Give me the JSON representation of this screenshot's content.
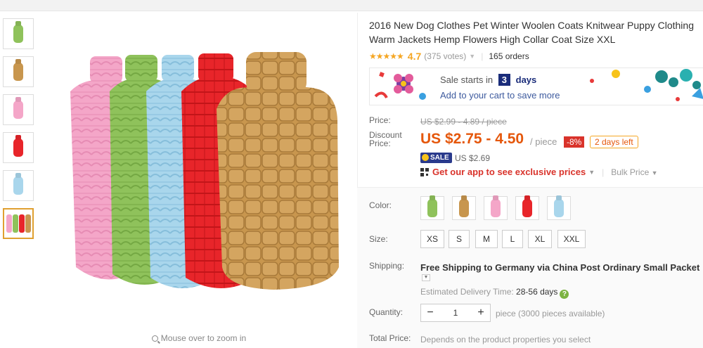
{
  "product": {
    "title": "2016 New Dog Clothes Pet Winter Woolen Coats Knitwear Puppy Clothing Warm Jackets Hemp Flowers High Collar Coat Size XXL",
    "rating": {
      "stars": "★★★★★",
      "value": "4.7",
      "votes": "(375 votes)",
      "orders": "165 orders"
    }
  },
  "thumbnails": [
    {
      "name": "green",
      "color": "#8fc25b"
    },
    {
      "name": "khaki",
      "color": "#c8964e"
    },
    {
      "name": "pink",
      "color": "#f4a6c8"
    },
    {
      "name": "red",
      "color": "#e8252a"
    },
    {
      "name": "light-blue",
      "color": "#a9d6ec"
    },
    {
      "name": "all-colors",
      "color": "multi"
    }
  ],
  "zoom_hint": "Mouse over to zoom in",
  "banner": {
    "sale_starts": "Sale starts in",
    "days_count": "3",
    "days_label": "days",
    "cta": "Add to your cart to save more"
  },
  "pricing": {
    "price_label": "Price:",
    "old_price": "US $2.99 - 4.89 / piece",
    "discount_label": "Discount Price:",
    "discount_price": "US $2.75 - 4.50",
    "per_piece": "/ piece",
    "discount_pct": "-8%",
    "days_left": "2 days left",
    "sale_badge": "SALE",
    "sale_price": "US $2.69",
    "app_prices": "Get our app to see exclusive prices",
    "bulk_price": "Bulk Price"
  },
  "options": {
    "color_label": "Color:",
    "colors": [
      "#8fc25b",
      "#c8964e",
      "#f4a6c8",
      "#e8252a",
      "#a9d6ec"
    ],
    "size_label": "Size:",
    "sizes": [
      "XS",
      "S",
      "M",
      "L",
      "XL",
      "XXL"
    ],
    "shipping_label": "Shipping:",
    "shipping_text": "Free Shipping to Germany via China Post Ordinary Small Packet",
    "delivery_label": "Estimated Delivery Time:",
    "delivery_days": "28-56 days",
    "quantity_label": "Quantity:",
    "quantity_value": "1",
    "quantity_available": "piece (3000 pieces available)",
    "total_label": "Total Price:",
    "total_note": "Depends on the product properties you select"
  },
  "colors": {
    "price_orange": "#e5570b",
    "star": "#f5a623",
    "banner_navy": "#1a2c7a",
    "discount_red": "#d9332b"
  }
}
